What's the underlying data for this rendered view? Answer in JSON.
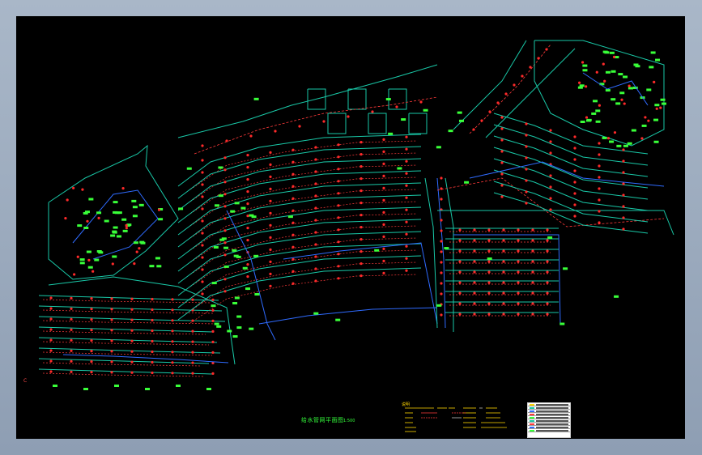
{
  "window": {
    "type": "CAD model space viewport",
    "background": "#000000",
    "frame_color": "#9aa9bd"
  },
  "colors": {
    "parcel_line": "#19c9a8",
    "pipe_line": "#2f6bff",
    "dash_line": "#ff3a3a",
    "node": "#ff2a2a",
    "label": "#39ff39",
    "text_yellow": "#ffd700",
    "text_white": "#ffffff"
  },
  "drawing": {
    "title": "给水管网平面图",
    "scale": "1:500",
    "left_marker": "C"
  },
  "notes": {
    "heading": "说明"
  },
  "legend": {
    "rows": 9
  }
}
